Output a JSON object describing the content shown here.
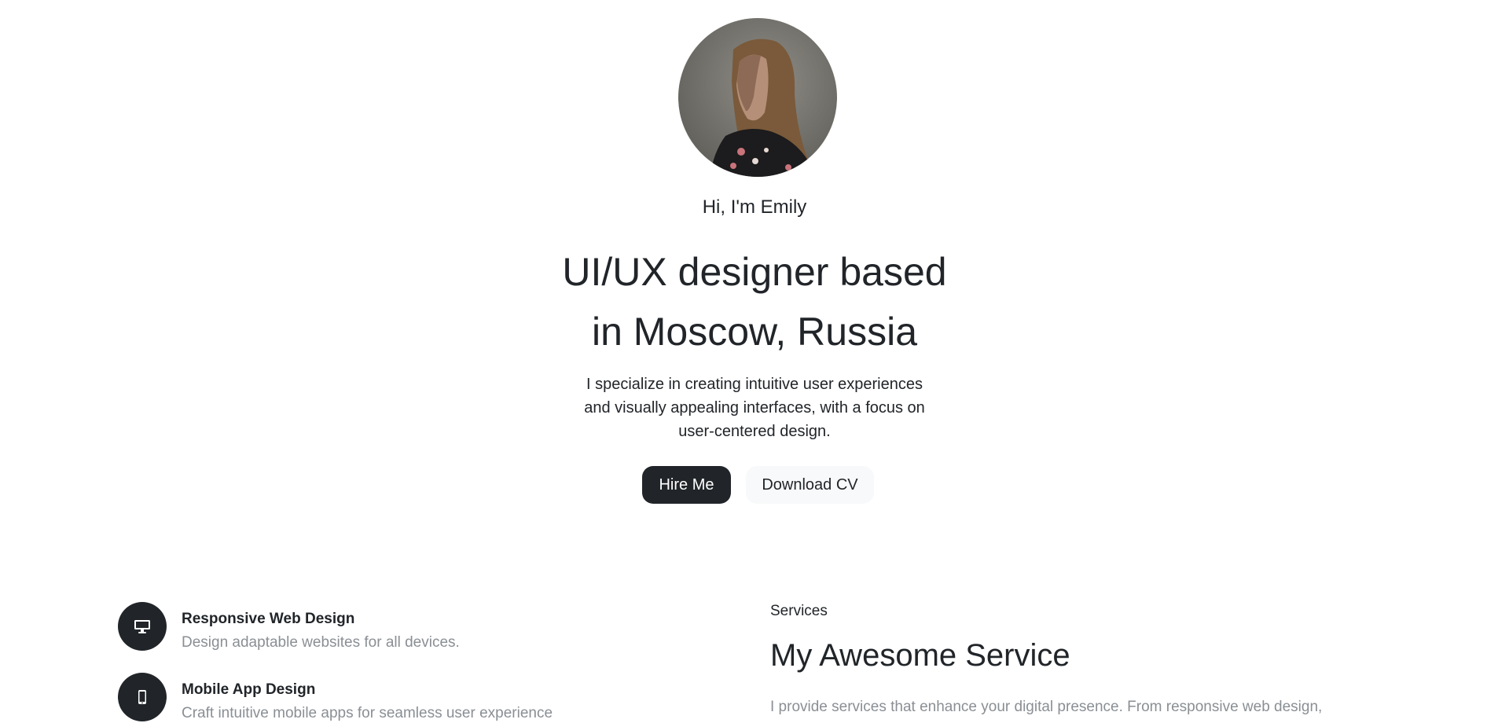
{
  "hero": {
    "greeting": "Hi, I'm Emily",
    "headline_line1": "UI/UX designer based",
    "headline_line2": "in Moscow, Russia",
    "intro_line1": "I specialize in creating intuitive user experiences",
    "intro_line2": "and visually appealing interfaces, with a focus on",
    "intro_line3": "user-centered design.",
    "hire_button": "Hire Me",
    "cv_button": "Download CV"
  },
  "services": {
    "items": [
      {
        "title": "Responsive Web Design",
        "description": "Design adaptable websites for all devices.",
        "icon": "desktop-icon"
      },
      {
        "title": "Mobile App Design",
        "description": "Craft intuitive mobile apps for seamless user experience",
        "icon": "mobile-icon"
      }
    ],
    "label": "Services",
    "title": "My Awesome Service",
    "text": "I provide services that enhance your digital presence. From responsive web design,"
  },
  "colors": {
    "primary_dark": "#212529",
    "muted_text": "#8a8f94",
    "light_button": "#f8f9fa"
  }
}
